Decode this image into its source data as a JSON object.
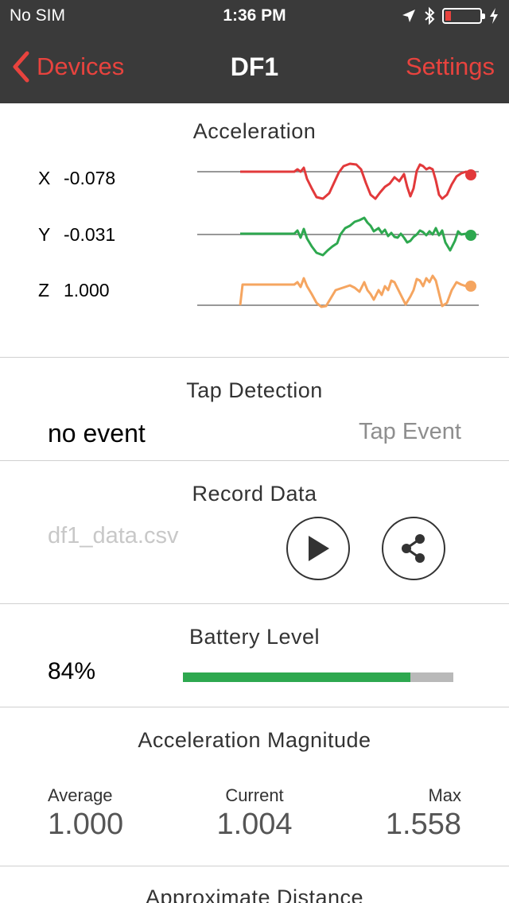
{
  "status_bar": {
    "carrier": "No SIM",
    "time": "1:36 PM",
    "icons": [
      "location-arrow-icon",
      "bluetooth-icon",
      "battery-icon",
      "charging-bolt-icon"
    ],
    "battery_level": 0.15
  },
  "nav": {
    "back_label": "Devices",
    "title": "DF1",
    "settings_label": "Settings"
  },
  "colors": {
    "accent": "#e8433e",
    "x_series": "#e2393b",
    "y_series": "#2ea84f",
    "z_series": "#f5a560",
    "battery_fill": "#2ea84f"
  },
  "acceleration": {
    "title": "Acceleration",
    "axes": [
      {
        "axis": "X",
        "value": "-0.078"
      },
      {
        "axis": "Y",
        "value": "-0.031"
      },
      {
        "axis": "Z",
        "value": "1.000"
      }
    ]
  },
  "tap_detection": {
    "title": "Tap Detection",
    "value": "no event",
    "event_label": "Tap Event"
  },
  "record_data": {
    "title": "Record Data",
    "filename": "df1_data.csv",
    "buttons": [
      "play-icon",
      "share-icon"
    ]
  },
  "battery": {
    "title": "Battery Level",
    "percent_text": "84%",
    "level": 0.84
  },
  "magnitude": {
    "title": "Acceleration Magnitude",
    "average_label": "Average",
    "average_value": "1.000",
    "current_label": "Current",
    "current_value": "1.004",
    "max_label": "Max",
    "max_value": "1.558"
  },
  "distance": {
    "title": "Approximate Distance"
  }
}
